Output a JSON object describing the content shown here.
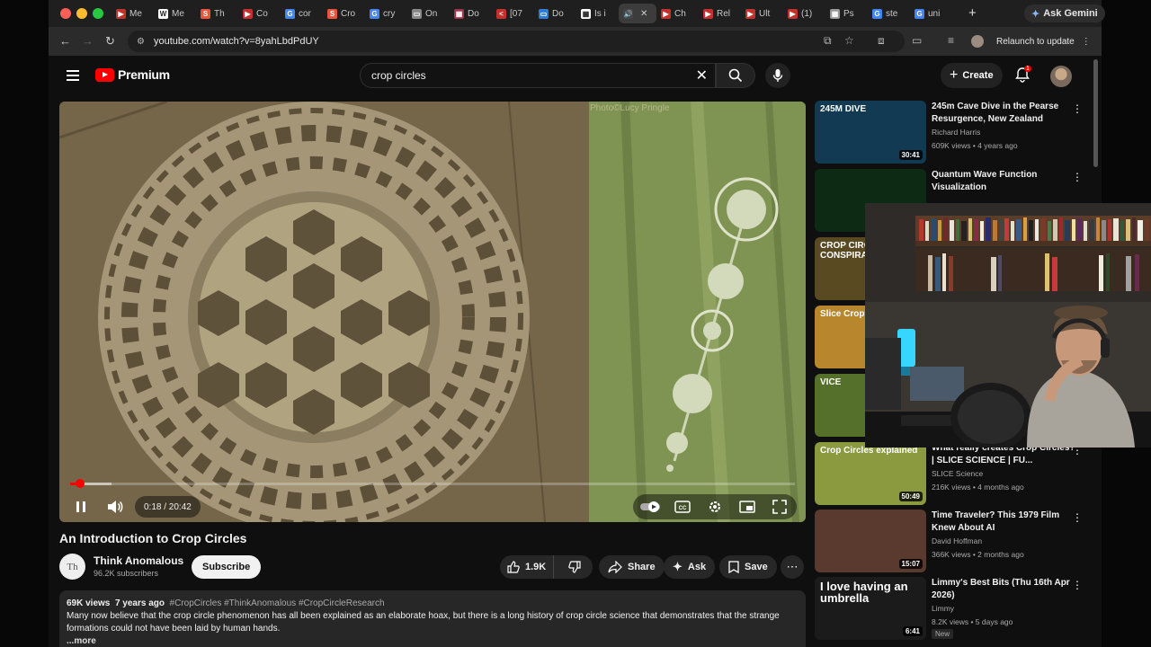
{
  "browser": {
    "tabs": [
      {
        "label": "Me",
        "favicon": "#c4302b",
        "glyph": "▶"
      },
      {
        "label": "Me",
        "favicon": "#ffffff",
        "glyph": "W"
      },
      {
        "label": "Th",
        "favicon": "#e8553a",
        "glyph": "S"
      },
      {
        "label": "Co",
        "favicon": "#c4302b",
        "glyph": "▶"
      },
      {
        "label": "cor",
        "favicon": "#4285f4",
        "glyph": "G"
      },
      {
        "label": "Cro",
        "favicon": "#e8553a",
        "glyph": "S"
      },
      {
        "label": "cry",
        "favicon": "#4285f4",
        "glyph": "G"
      },
      {
        "label": "On",
        "favicon": "#888888",
        "glyph": "▭"
      },
      {
        "label": "Do",
        "favicon": "#a3324f",
        "glyph": "▦"
      },
      {
        "label": "[07",
        "favicon": "#c4302b",
        "glyph": "<"
      },
      {
        "label": "Do",
        "favicon": "#2f7bd6",
        "glyph": "▭"
      },
      {
        "label": "Is i",
        "favicon": "#ffffff",
        "glyph": "▦"
      },
      {
        "label": "",
        "favicon": "#444444",
        "glyph": "🔊",
        "active": true
      },
      {
        "label": "Ch",
        "favicon": "#c4302b",
        "glyph": "▶"
      },
      {
        "label": "Rel",
        "favicon": "#c4302b",
        "glyph": "▶"
      },
      {
        "label": "Ult",
        "favicon": "#c4302b",
        "glyph": "▶"
      },
      {
        "label": "(1)",
        "favicon": "#c4302b",
        "glyph": "▶"
      },
      {
        "label": "Ps",
        "favicon": "#999999",
        "glyph": "▦"
      },
      {
        "label": "ste",
        "favicon": "#4285f4",
        "glyph": "G"
      },
      {
        "label": "uni",
        "favicon": "#4285f4",
        "glyph": "G"
      }
    ],
    "gemini_label": "Ask Gemini",
    "url": "youtube.com/watch?v=8yahLbdPdUY",
    "relaunch_label": "Relaunch to update"
  },
  "youtube": {
    "logo_text": "Premium",
    "search_value": "crop circles",
    "create_label": "Create",
    "notification_count": "1"
  },
  "player": {
    "photo_credit": "Photo©Lucy Pringle",
    "time_display": "0:18 / 20:42",
    "progress_fraction": 0.014
  },
  "video": {
    "title": "An Introduction to Crop Circles",
    "channel_name": "Think Anomalous",
    "channel_initials": "Th",
    "subscribers": "96.2K subscribers",
    "subscribe_label": "Subscribe",
    "likes": "1.9K",
    "share_label": "Share",
    "ask_label": "Ask",
    "save_label": "Save",
    "views": "69K views",
    "age": "7 years ago",
    "hashtags": "#CropCircles #ThinkAnomalous #CropCircleResearch",
    "description": "Many now believe that the crop circle phenomenon has all been explained as an elaborate hoax, but there is a long history of crop circle science that demonstrates that the strange formations could not have been laid by human hands.",
    "more_label": "...more"
  },
  "recommendations": [
    {
      "title": "245m Cave Dive in the Pearse Resurgence, New Zealand",
      "channel": "Richard Harris",
      "meta": "609K views • 4 years ago",
      "duration": "30:41",
      "thumb_text": "245M DIVE",
      "thumb_color": "#123a52"
    },
    {
      "title": "Quantum Wave Function Visualization",
      "channel": "",
      "meta": "",
      "duration": "",
      "thumb_text": "",
      "thumb_color": "#0c2a14"
    },
    {
      "title": "",
      "channel": "",
      "meta": "",
      "duration": "",
      "thumb_text": "CROP CIRC CONSPIRA",
      "thumb_color": "#5a4a22"
    },
    {
      "title": "",
      "channel": "",
      "meta": "",
      "duration": "",
      "thumb_text": "Slice Crop",
      "thumb_color": "#b8862c"
    },
    {
      "title": "",
      "channel": "",
      "meta": "",
      "duration": "",
      "thumb_text": "VICE",
      "thumb_color": "#55702a"
    },
    {
      "title": "What really creates Crop Circles? | SLICE SCIENCE | FU...",
      "channel": "SLICE Science",
      "meta": "216K views • 4 months ago",
      "duration": "50:49",
      "thumb_text": "Crop Circles explained",
      "thumb_color": "#8b9a3e"
    },
    {
      "title": "Time Traveler? This 1979 Film Knew About AI",
      "channel": "David Hoffman",
      "meta": "366K views • 2 months ago",
      "duration": "15:07",
      "thumb_text": "",
      "thumb_color": "#5a3a2e"
    },
    {
      "title": "Limmy's Best Bits (Thu 16th Apr 2026)",
      "channel": "Limmy",
      "meta": "8.2K views • 5 days ago",
      "duration": "6:41",
      "thumb_text": "I love having an umbrella",
      "thumb_color": "#1b1b1b",
      "badge": "New"
    }
  ]
}
